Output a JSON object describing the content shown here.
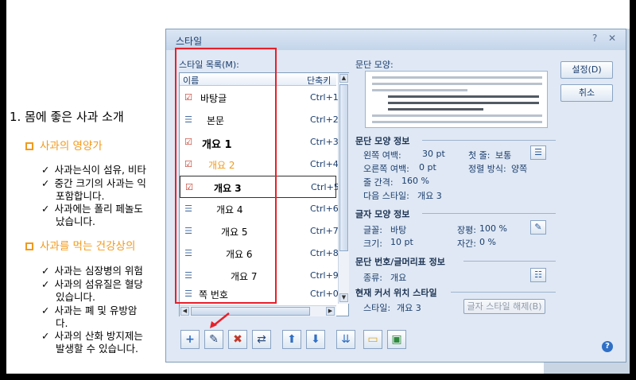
{
  "document": {
    "heading": "1. 몸에 좋은 사과 소개",
    "subheading1": "사과의 영양가",
    "bullets1": [
      "사과는식이 섬유, 비타",
      "중간 크기의 사과는 익",
      "포함합니다.",
      "사과에는 폴리 페놀도",
      "났습니다."
    ],
    "subheading2": "사과를 먹는 건강상의",
    "bullets2": [
      "사과는 심장병의 위험",
      "사과의 섬유질은 혈당",
      "있습니다.",
      "사과는 폐 및 유방암",
      "다.",
      "사과의 산화 방지제는",
      "발생할 수 있습니다."
    ],
    "check_glyph": "✓",
    "square_glyph": ""
  },
  "dialog": {
    "title": "스타일",
    "help_glyph": "?",
    "close_glyph": "✕",
    "list_label": "스타일 목록(M):",
    "col_name": "이름",
    "col_shortcut": "단축키",
    "styles": [
      {
        "name": "바탕글",
        "shortcut": "Ctrl+1",
        "icon": "check"
      },
      {
        "name": "본문",
        "shortcut": "Ctrl+2",
        "icon": "list"
      },
      {
        "name": "개요 1",
        "shortcut": "Ctrl+3",
        "icon": "check"
      },
      {
        "name": "개요 2",
        "shortcut": "Ctrl+4",
        "icon": "check"
      },
      {
        "name": "개요 3",
        "shortcut": "Ctrl+5",
        "icon": "check"
      },
      {
        "name": "개요 4",
        "shortcut": "Ctrl+6",
        "icon": "list"
      },
      {
        "name": "개요 5",
        "shortcut": "Ctrl+7",
        "icon": "list"
      },
      {
        "name": "개요 6",
        "shortcut": "Ctrl+8",
        "icon": "list"
      },
      {
        "name": "개요 7",
        "shortcut": "Ctrl+9",
        "icon": "list"
      },
      {
        "name": "쪽 번호",
        "shortcut": "Ctrl+0",
        "icon": "list"
      }
    ],
    "preview_label": "문단 모양:",
    "set_button": "설정(D)",
    "cancel_button": "취소",
    "para_info_title": "문단 모양 정보",
    "left_margin_label": "왼쪽 여백:",
    "left_margin_value": "30 pt",
    "first_line_label": "첫 줄:",
    "first_line_value": "보통",
    "right_margin_label": "오른쪽 여백:",
    "right_margin_value": "0 pt",
    "align_label": "정렬 방식:",
    "align_value": "양쪽",
    "line_spacing_label": "줄 간격:",
    "line_spacing_value": "160 %",
    "next_style_label": "다음 스타일:",
    "next_style_value": "개요 3",
    "char_info_title": "글자 모양 정보",
    "font_label": "글꼴:",
    "font_value": "바탕",
    "ratio_label": "장평:",
    "ratio_value": "100 %",
    "size_label": "크기:",
    "size_value": "10 pt",
    "spacing_label": "자간:",
    "spacing_value": "0 %",
    "numbering_title": "문단 번호/글머리표 정보",
    "type_label": "종류:",
    "type_value": "개요",
    "cursor_title": "현재 커서 위치 스타일",
    "cursor_style_label": "스타일:",
    "cursor_style_value": "개요 3",
    "release_button": "글자 스타일 해제(B)",
    "toolbar": {
      "add": "+",
      "edit": "✎",
      "delete": "✖",
      "replace": "⇄",
      "up": "⬆",
      "down": "⬇",
      "import": "⇊",
      "open": "▭",
      "save": "▣"
    },
    "help_circle": "?"
  },
  "colors": {
    "accent_red": "#e8202a",
    "orange": "#f29a1b",
    "dialog_bg": "#dfe8f4"
  }
}
